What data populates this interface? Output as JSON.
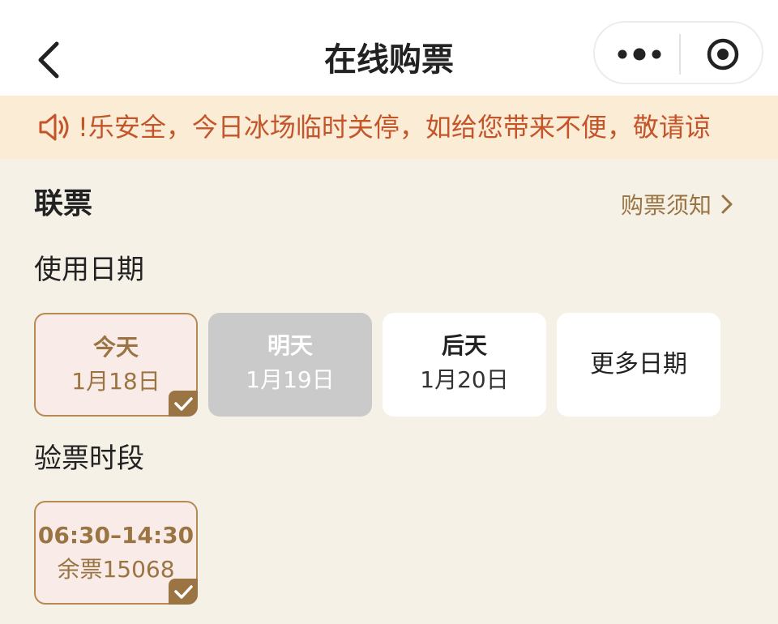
{
  "navbar": {
    "title": "在线购票",
    "back_icon": "chevron-left-icon",
    "more_icon": "more-dots-icon",
    "close_icon": "target-close-icon"
  },
  "notice": {
    "icon": "speaker-icon",
    "text": "!乐安全，今日冰场临时关停，如给您带来不便，敬请谅"
  },
  "section": {
    "title": "联票",
    "link_label": "购票须知"
  },
  "date_section": {
    "label": "使用日期",
    "options": [
      {
        "day": "今天",
        "date": "1月18日",
        "state": "selected"
      },
      {
        "day": "明天",
        "date": "1月19日",
        "state": "disabled"
      },
      {
        "day": "后天",
        "date": "1月20日",
        "state": "normal"
      }
    ],
    "more_label": "更多日期"
  },
  "time_section": {
    "label": "验票时段",
    "slots": [
      {
        "time": "06:30–14:30",
        "remaining": "余票15068",
        "state": "selected"
      }
    ]
  },
  "colors": {
    "accent": "#9a7443",
    "notice_text": "#c4552b",
    "notice_bg": "#fbecd5",
    "page_bg": "#f6f1e6",
    "selected_bg": "#f9ebe7",
    "disabled_bg": "#cacaca"
  }
}
